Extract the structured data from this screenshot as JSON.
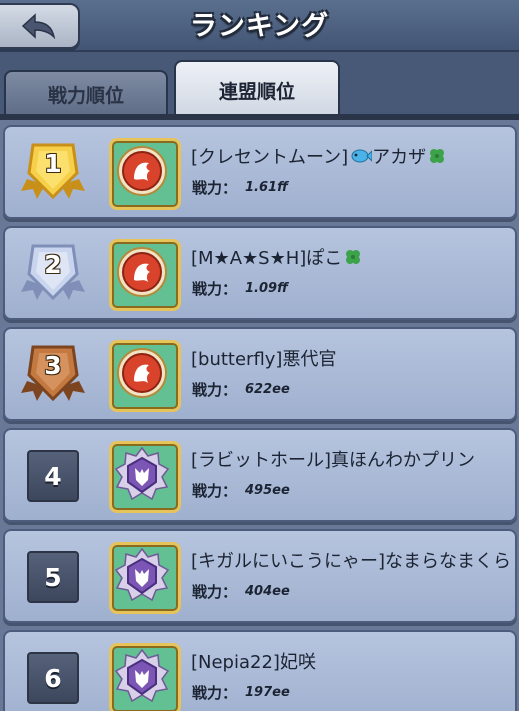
{
  "header": {
    "title": "ランキング",
    "back_icon": "back-arrow-icon"
  },
  "tabs": [
    {
      "label": "戦力順位",
      "active": false
    },
    {
      "label": "連盟順位",
      "active": true
    }
  ],
  "power_label": "戦力：",
  "rows": [
    {
      "rank": "1",
      "badge": "gold",
      "emblem": "lion",
      "name": "[クレセントムーン]",
      "name_suffix": "アカザ",
      "icons": [
        "fish-icon",
        "clover-icon"
      ],
      "power": "1.61ff"
    },
    {
      "rank": "2",
      "badge": "silver",
      "emblem": "lion",
      "name": "[M★A★S★H]ぽこ",
      "name_suffix": "",
      "icons": [
        "clover-icon"
      ],
      "power": "1.09ff"
    },
    {
      "rank": "3",
      "badge": "bronze",
      "emblem": "lion",
      "name": "[butterfly]悪代官",
      "name_suffix": "",
      "icons": [],
      "power": "622ee"
    },
    {
      "rank": "4",
      "badge": "plain",
      "emblem": "wolf",
      "name": "[ラビットホール]真ほんわかプリン",
      "name_suffix": "",
      "icons": [],
      "power": "495ee"
    },
    {
      "rank": "5",
      "badge": "plain",
      "emblem": "wolf",
      "name": "[キガルにいこうにゃー]なまらなまくら",
      "name_suffix": "",
      "icons": [],
      "power": "404ee"
    },
    {
      "rank": "6",
      "badge": "plain",
      "emblem": "wolf",
      "name": "[Nepia22]妃咲",
      "name_suffix": "",
      "icons": [],
      "power": "197ee"
    }
  ],
  "colors": {
    "gold": "#f2c230",
    "silver": "#b9c6e6",
    "bronze": "#b86a34",
    "lion_bg": "#d9432c",
    "wolf_bg": "#7b56b4",
    "row_bg": "#aebcd8"
  }
}
